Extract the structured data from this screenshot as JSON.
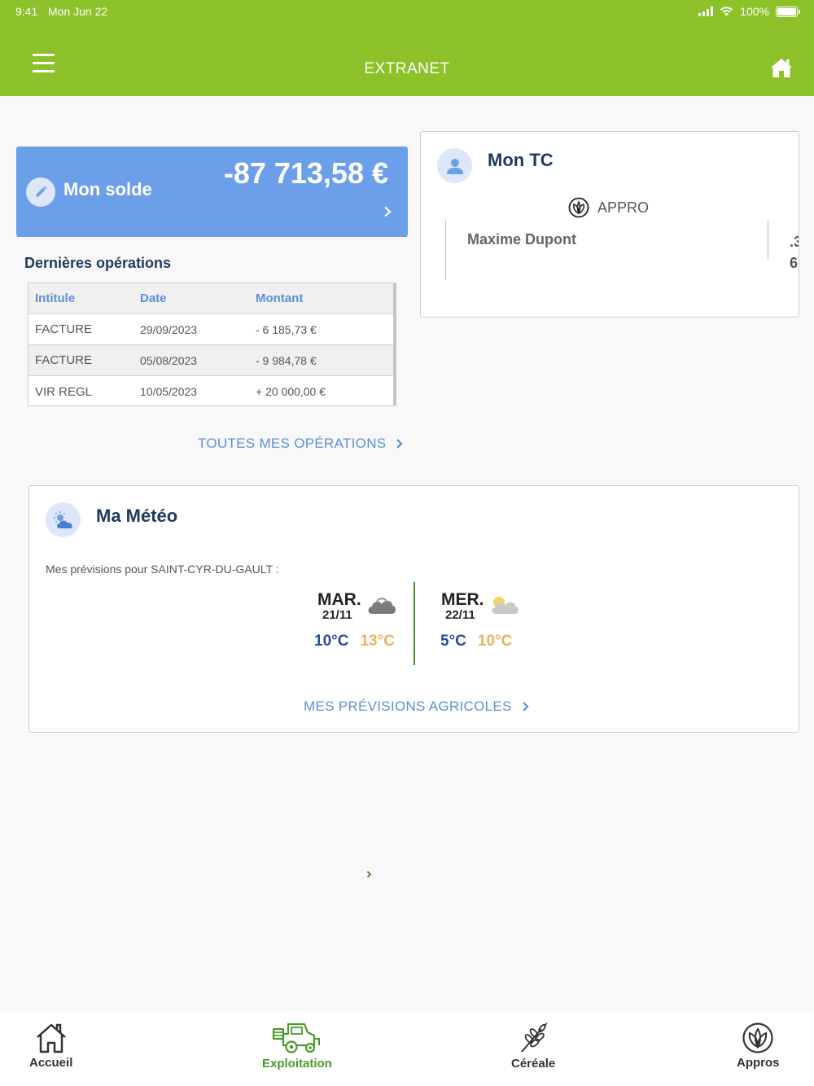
{
  "status_bar": {
    "time": "9:41",
    "date": "Mon Jun 22",
    "battery": "100%"
  },
  "header": {
    "title": "EXTRANET"
  },
  "solde": {
    "label": "Mon solde",
    "amount": "-87 713,58 €"
  },
  "operations": {
    "title": "Dernières opérations",
    "headers": [
      "Intitule",
      "Date",
      "Montant"
    ],
    "rows": [
      [
        "FACTURE",
        "29/09/2023",
        "- 6 185,73 €"
      ],
      [
        "FACTURE",
        "05/08/2023",
        "- 9 984,78 €"
      ],
      [
        "VIR REGL",
        "10/05/2023",
        "+ 20 000,00 €"
      ]
    ],
    "link": "TOUTES MES OPÉRATIONS"
  },
  "tc": {
    "title": "Mon TC",
    "category": "APPRO",
    "name": "Maxime Dupont",
    "extra_line1": ".3",
    "extra_line2": "6"
  },
  "meteo": {
    "title": "Ma Météo",
    "subtitle": "Mes prévisions pour SAINT-CYR-DU-GAULT :",
    "days": [
      {
        "name": "MAR.",
        "date": "21/11",
        "min": "10°C",
        "max": "13°C",
        "icon": "cloudy-icon"
      },
      {
        "name": "MER.",
        "date": "22/11",
        "min": "5°C",
        "max": "10°C",
        "icon": "partly-sunny-icon"
      }
    ],
    "link": "MES PRÉVISIONS AGRICOLES"
  },
  "tabbar": {
    "items": [
      {
        "label": "Accueil",
        "icon": "home-outline-icon",
        "active": false
      },
      {
        "label": "Exploitation",
        "icon": "harvester-icon",
        "active": true
      },
      {
        "label": "Céréale",
        "icon": "wheat-icon",
        "active": false
      },
      {
        "label": "Appros",
        "icon": "leaf-circle-icon",
        "active": false
      }
    ]
  },
  "colors": {
    "brand_green": "#8dc12a",
    "solde_blue": "#6c9fea",
    "link_blue": "#5b8fd9",
    "active_tab": "#4a9a28"
  }
}
